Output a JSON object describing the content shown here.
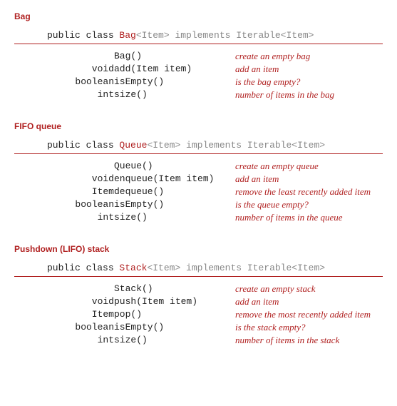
{
  "sections": [
    {
      "title": "Bag",
      "decl": {
        "kw": "public class ",
        "cls": "Bag",
        "gen": "<Item>",
        "impl": " implements Iterable<Item>"
      },
      "rows": [
        {
          "ret": "",
          "sig": "Bag()",
          "desc": "create an empty bag"
        },
        {
          "ret": "void",
          "sig": "add(Item item)",
          "desc": "add an item"
        },
        {
          "ret": "boolean",
          "sig": "isEmpty()",
          "desc": "is the bag empty?"
        },
        {
          "ret": "int",
          "sig": "size()",
          "desc": "number of items in the bag"
        }
      ]
    },
    {
      "title": "FIFO queue",
      "decl": {
        "kw": "public class ",
        "cls": "Queue",
        "gen": "<Item>",
        "impl": " implements Iterable<Item>"
      },
      "rows": [
        {
          "ret": "",
          "sig": "Queue()",
          "desc": "create an empty queue"
        },
        {
          "ret": "void",
          "sig": "enqueue(Item item)",
          "desc": "add an item"
        },
        {
          "ret": "Item",
          "sig": "dequeue()",
          "desc": "remove the least recently added item"
        },
        {
          "ret": "boolean",
          "sig": "isEmpty()",
          "desc": "is the queue empty?"
        },
        {
          "ret": "int",
          "sig": "size()",
          "desc": "number of items in the queue"
        }
      ]
    },
    {
      "title": "Pushdown (LIFO) stack",
      "decl": {
        "kw": "public class ",
        "cls": "Stack",
        "gen": "<Item>",
        "impl": " implements Iterable<Item>"
      },
      "rows": [
        {
          "ret": "",
          "sig": "Stack()",
          "desc": "create an empty stack"
        },
        {
          "ret": "void",
          "sig": "push(Item item)",
          "desc": "add an item"
        },
        {
          "ret": "Item",
          "sig": "pop()",
          "desc": "remove the most recently added item"
        },
        {
          "ret": "boolean",
          "sig": "isEmpty()",
          "desc": "is the stack empty?"
        },
        {
          "ret": "int",
          "sig": "size()",
          "desc": "number of items in the stack"
        }
      ]
    }
  ]
}
